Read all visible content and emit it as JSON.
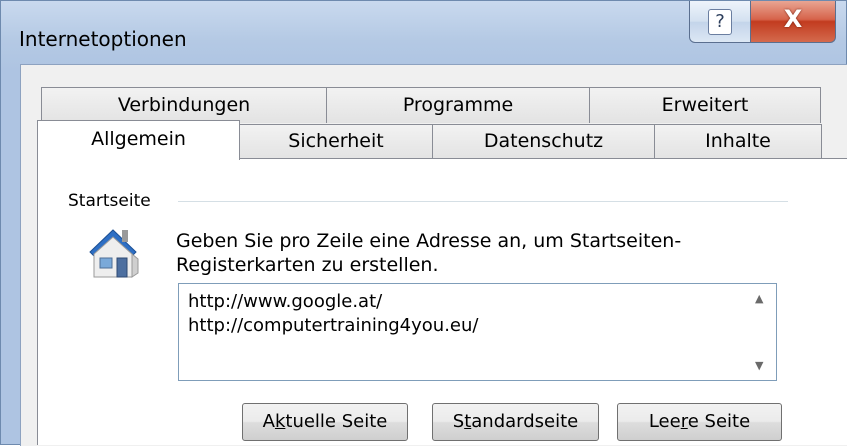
{
  "window": {
    "title": "Internetoptionen",
    "help_glyph": "?",
    "close_glyph": "X"
  },
  "tabs_back": [
    "Verbindungen",
    "Programme",
    "Erweitert"
  ],
  "tabs_front": [
    "Allgemein",
    "Sicherheit",
    "Datenschutz",
    "Inhalte"
  ],
  "startseite": {
    "group_label": "Startseite",
    "description_line1": "Geben Sie pro Zeile eine Adresse an, um Startseiten-",
    "description_line2": "Registerkarten zu erstellen.",
    "urls": [
      "http://www.google.at/",
      "http://computertraining4you.eu/"
    ]
  },
  "buttons": {
    "current": {
      "pre": "A",
      "key": "k",
      "post": "tuelle Seite"
    },
    "default": {
      "pre": "S",
      "key": "t",
      "post": "andardseite"
    },
    "blank": {
      "pre": "Lee",
      "key": "r",
      "post": "e Seite"
    }
  },
  "colors": {
    "close_red": "#c23b1f",
    "title_bar": "#b4c9e4",
    "border_blue": "#7f9db9"
  }
}
